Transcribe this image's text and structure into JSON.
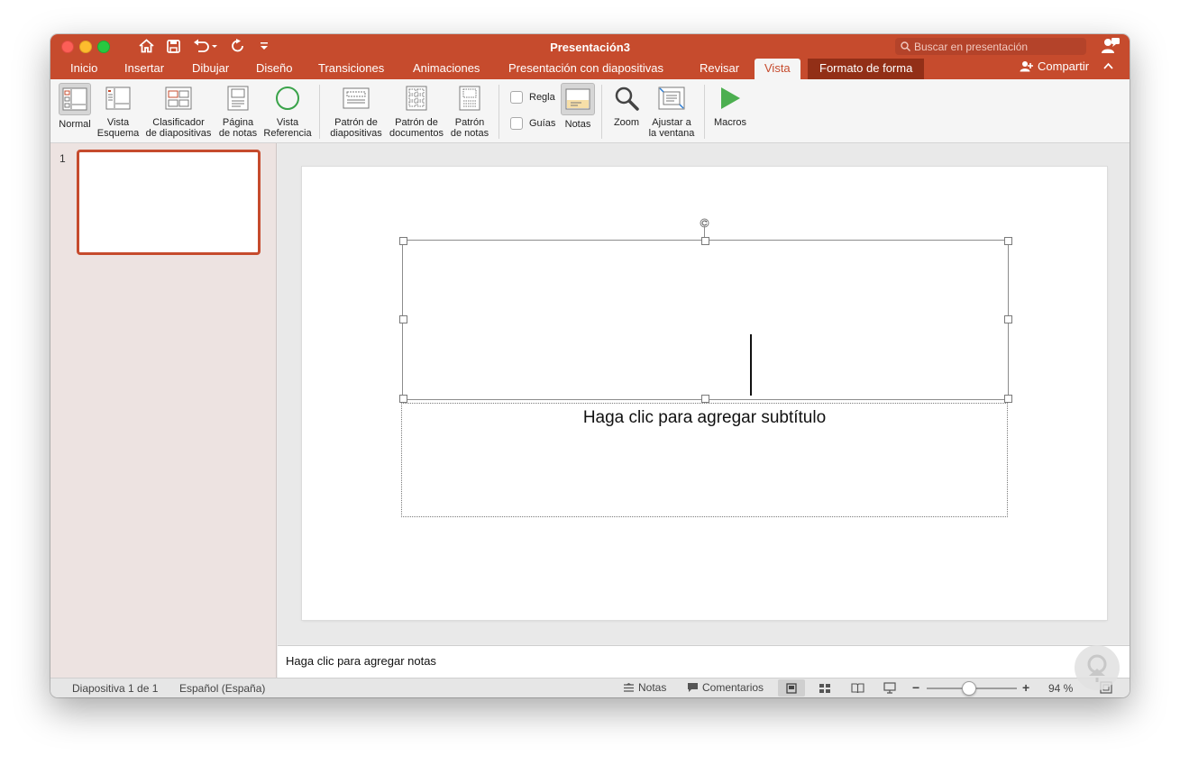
{
  "window": {
    "title": "Presentación3"
  },
  "search": {
    "placeholder": "Buscar en presentación"
  },
  "tabs": [
    "Inicio",
    "Insertar",
    "Dibujar",
    "Diseño",
    "Transiciones",
    "Animaciones",
    "Presentación con diapositivas",
    "Revisar",
    "Vista",
    "Formato de forma"
  ],
  "active_tab": "Vista",
  "share_label": "Compartir",
  "ribbon": {
    "normal": {
      "l1": "Normal",
      "l2": ""
    },
    "outline": {
      "l1": "Vista",
      "l2": "Esquema"
    },
    "sorter": {
      "l1": "Clasificador",
      "l2": "de diapositivas"
    },
    "notes_page": {
      "l1": "Página",
      "l2": "de notas"
    },
    "reading": {
      "l1": "Vista",
      "l2": "Referencia"
    },
    "slide_master": {
      "l1": "Patrón de",
      "l2": "diapositivas"
    },
    "handout_master": {
      "l1": "Patrón de",
      "l2": "documentos"
    },
    "notes_master": {
      "l1": "Patrón",
      "l2": "de notas"
    },
    "ruler": "Regla",
    "guides": "Guías",
    "notes": "Notas",
    "zoom": {
      "l1": "Zoom",
      "l2": ""
    },
    "fit": {
      "l1": "Ajustar a",
      "l2": "la ventana"
    },
    "macros": {
      "l1": "Macros",
      "l2": ""
    }
  },
  "thumbnails": [
    {
      "number": "1"
    }
  ],
  "slide": {
    "subtitle_placeholder": "Haga clic para agregar subtítulo"
  },
  "notes_placeholder": "Haga clic para agregar notas",
  "status": {
    "slide_count": "Diapositiva 1 de 1",
    "language": "Español (España)",
    "notes": "Notas",
    "comments": "Comentarios",
    "zoom_minus": "−",
    "zoom_plus": "+",
    "zoom": "94 %"
  },
  "colors": {
    "accent": "#c64b2d",
    "context_tab": "#922f17",
    "sidebar": "#ede3e1"
  }
}
